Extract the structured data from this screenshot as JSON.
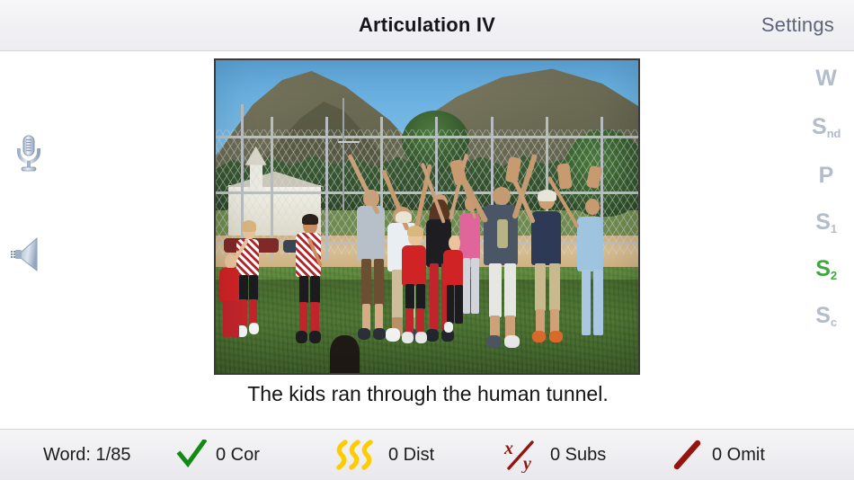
{
  "header": {
    "title": "Articulation IV",
    "settings_label": "Settings"
  },
  "left_rail": {
    "items": [
      {
        "name": "microphone-button",
        "icon": "microphone-icon",
        "label": "Record"
      },
      {
        "name": "speaker-button",
        "icon": "speaker-icon",
        "label": "Play audio"
      }
    ]
  },
  "right_rail": {
    "active_color": "#3fa940",
    "inactive_color": "#b2bcca",
    "items": [
      {
        "letter": "W",
        "sub": "",
        "active": false
      },
      {
        "letter": "S",
        "sub": "nd",
        "active": false
      },
      {
        "letter": "P",
        "sub": "",
        "active": false
      },
      {
        "letter": "S",
        "sub": "1",
        "active": false
      },
      {
        "letter": "S",
        "sub": "2",
        "active": true
      },
      {
        "letter": "S",
        "sub": "c",
        "active": false
      }
    ]
  },
  "main": {
    "photo_alt": "Children running through a tunnel of adults with raised arms on a grass sports field",
    "caption": "The kids ran through the human tunnel."
  },
  "status_bar": {
    "word_counter": "Word: 1/85",
    "stats": [
      {
        "key": "correct",
        "icon": "checkmark-icon",
        "label": "0 Cor",
        "color": "#138a13"
      },
      {
        "key": "distortions",
        "icon": "squiggles-icon",
        "label": "0 Dist",
        "color": "#ffcc00"
      },
      {
        "key": "substitutions",
        "icon": "x-over-y-icon",
        "label": "0 Subs",
        "color": "#951410"
      },
      {
        "key": "omissions",
        "icon": "slash-icon",
        "label": "0 Omit",
        "color": "#951410"
      }
    ]
  }
}
